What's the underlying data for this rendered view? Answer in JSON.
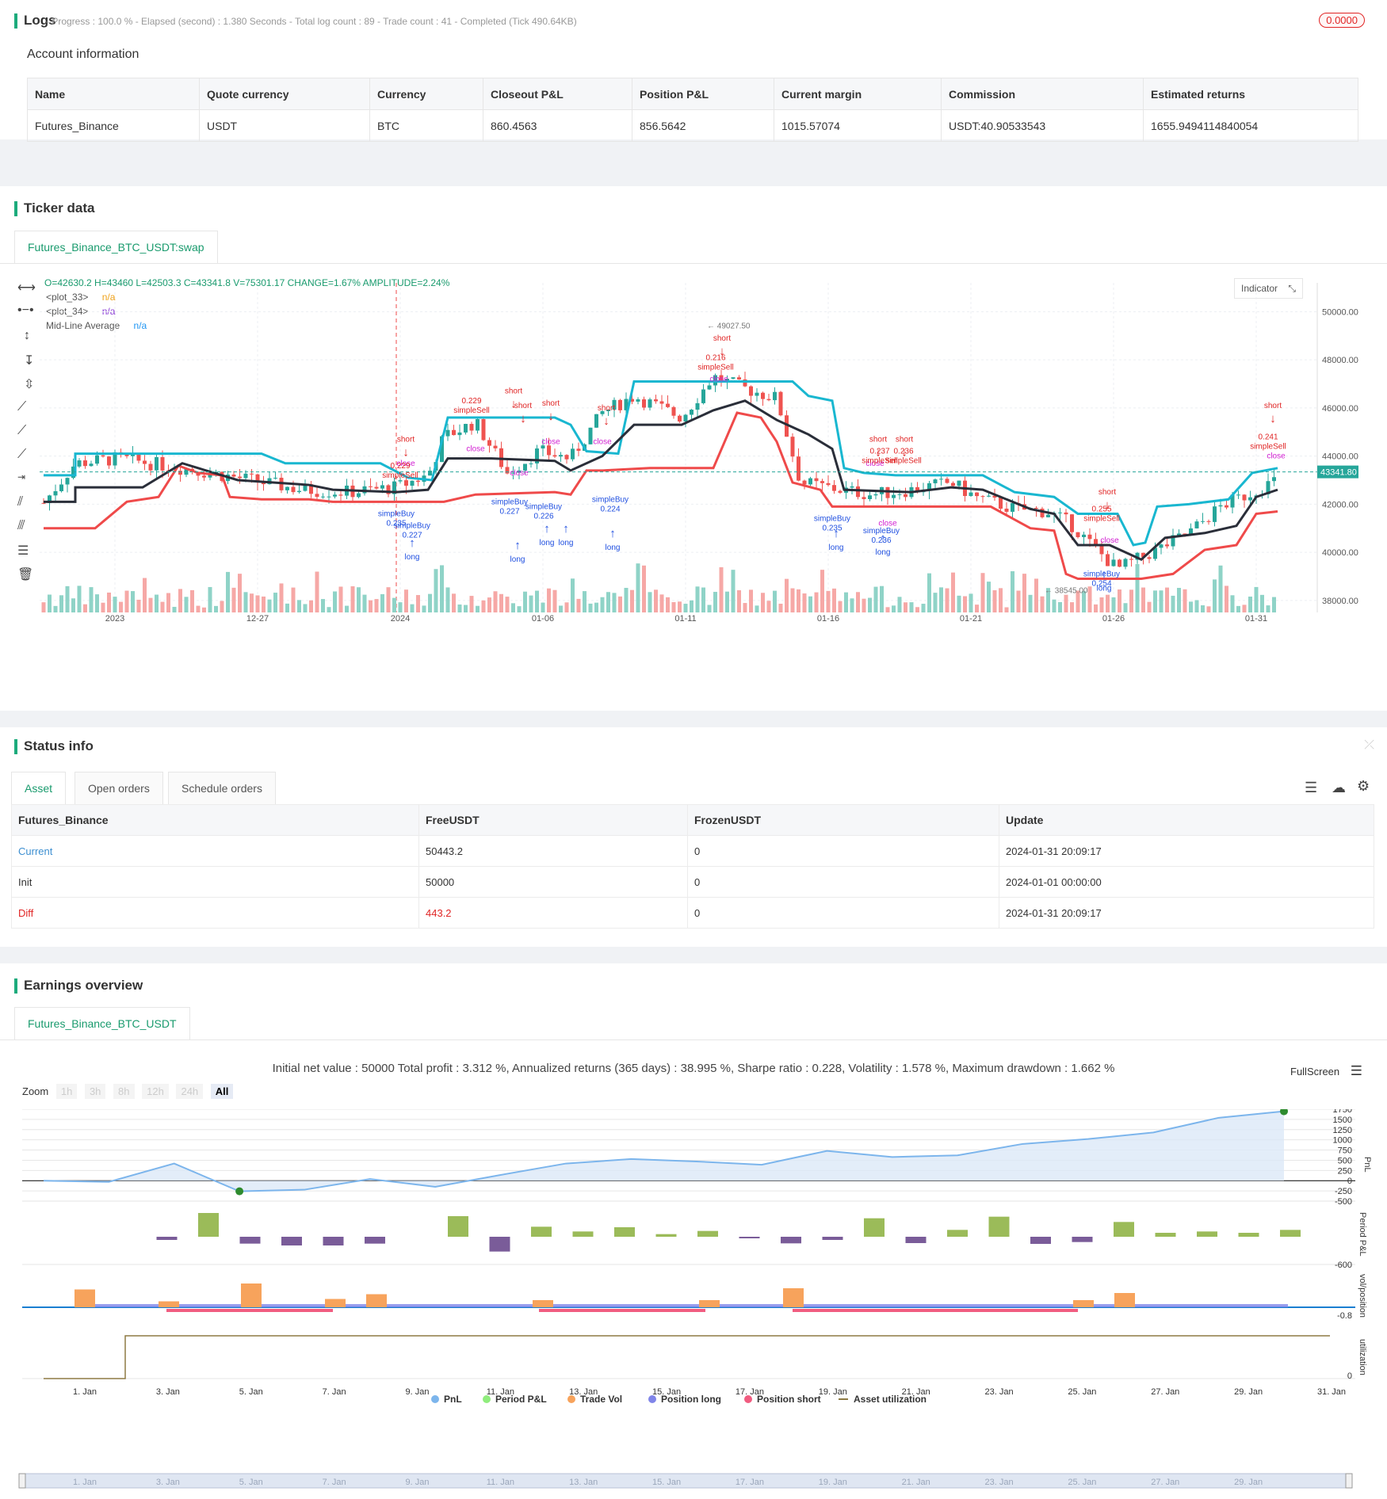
{
  "logs": {
    "title": "Logs",
    "summary": "- Progress : 100.0 % - Elapsed (second) : 1.380 Seconds - Total log count : 89 - Trade count : 41 - Completed (Tick 490.64KB)",
    "badge": "0.0000"
  },
  "account": {
    "heading": "Account information",
    "columns": [
      "Name",
      "Quote currency",
      "Currency",
      "Closeout P&L",
      "Position P&L",
      "Current margin",
      "Commission",
      "Estimated returns"
    ],
    "row": [
      "Futures_Binance",
      "USDT",
      "BTC",
      "860.4563",
      "856.5642",
      "1015.57074",
      "USDT:40.90533543",
      "1655.9494114840054"
    ]
  },
  "ticker": {
    "title": "Ticker data",
    "tab": "Futures_Binance_BTC_USDT:swap",
    "ohlc": "O=42630.2 H=43460 L=42503.3 C=43341.8 V=75301.17 CHANGE=1.67% AMPLITUDE=2.24%",
    "legend": [
      {
        "name": "<plot_33>",
        "value": "n/a",
        "color": "#f0a21a"
      },
      {
        "name": "<plot_34>",
        "value": "n/a",
        "color": "#8c3fd6"
      },
      {
        "name": "Mid-Line Average",
        "value": "n/a",
        "color": "#2196f3"
      }
    ],
    "indicator_btn": "Indicator",
    "last_price": "43341.80",
    "high_label": "49027.50",
    "low_label": "38545.00"
  },
  "chart_data": {
    "type": "candlestick",
    "price_axis": [
      "50000.00",
      "48000.00",
      "46000.00",
      "44000.00",
      "42000.00",
      "40000.00",
      "38000.00"
    ],
    "price_range": [
      37500,
      51200
    ],
    "time_axis": [
      "2023",
      "12-27",
      "2024",
      "01-06",
      "01-11",
      "01-16",
      "01-21",
      "01-26",
      "01-31"
    ],
    "series": [
      {
        "name": "upper",
        "color": "#19b7d0"
      },
      {
        "name": "lower",
        "color": "#ef4a4a"
      },
      {
        "name": "mid",
        "color": "#2a2e39"
      }
    ],
    "current_price": 43341.8,
    "signal_labels": [
      "short",
      "long",
      "close",
      "simpleBuy",
      "simpleSell",
      "0.229",
      "0.235",
      "0.227",
      "0.226",
      "0.224",
      "0.216",
      "0.237",
      "0.236",
      "0.255",
      "0.254",
      "0.241"
    ]
  },
  "status": {
    "title": "Status info",
    "tabs": [
      "Asset",
      "Open orders",
      "Schedule orders"
    ],
    "columns": [
      "Futures_Binance",
      "FreeUSDT",
      "FrozenUSDT",
      "Update"
    ],
    "rows": [
      {
        "label": "Current",
        "free": "50443.2",
        "frozen": "0",
        "update": "2024-01-31 20:09:17",
        "color": "#3d8fd1"
      },
      {
        "label": "Init",
        "free": "50000",
        "frozen": "0",
        "update": "2024-01-01 00:00:00",
        "color": "#333333"
      },
      {
        "label": "Diff",
        "free": "443.2",
        "frozen": "0",
        "update": "2024-01-31 20:09:17",
        "color": "#e02424"
      }
    ]
  },
  "earnings": {
    "title": "Earnings overview",
    "tab": "Futures_Binance_BTC_USDT",
    "summary": "Initial net value : 50000 Total profit : 3.312 %, Annualized returns (365 days) : 38.995 %, Sharpe ratio : 0.228, Volatility : 1.578 %, Maximum drawdown : 1.662 %",
    "fullscreen": "FullScreen",
    "zoom_label": "Zoom",
    "zoom_options": [
      "1h",
      "3h",
      "8h",
      "12h",
      "24h",
      "All"
    ],
    "pnl_axis": [
      "1750",
      "1500",
      "1250",
      "1000",
      "750",
      "500",
      "250",
      "0",
      "-250",
      "-500"
    ],
    "period_axis": [
      "-600"
    ],
    "vol_axis": [
      "-0.8"
    ],
    "util_axis": [
      "0"
    ],
    "axis_titles": [
      "PnL",
      "Period P&L",
      "vol/position",
      "utilization"
    ],
    "x_axis": [
      "1. Jan",
      "3. Jan",
      "5. Jan",
      "7. Jan",
      "9. Jan",
      "11. Jan",
      "13. Jan",
      "15. Jan",
      "17. Jan",
      "19. Jan",
      "21. Jan",
      "23. Jan",
      "25. Jan",
      "27. Jan",
      "29. Jan",
      "31. Jan"
    ],
    "legend": [
      {
        "name": "PnL",
        "color": "#7cb5ec"
      },
      {
        "name": "Period P&L",
        "color": "#90ed7d"
      },
      {
        "name": "Trade Vol",
        "color": "#f7a35c"
      },
      {
        "name": "Position long",
        "color": "#8085e9"
      },
      {
        "name": "Position short",
        "color": "#f15c80"
      },
      {
        "name": "Asset utilization",
        "color": "#8d7a43"
      }
    ],
    "pnl_values": [
      0,
      -30,
      420,
      -260,
      -220,
      40,
      -150,
      140,
      420,
      530,
      470,
      390,
      730,
      580,
      620,
      900,
      1020,
      1180,
      1540,
      1700
    ],
    "period_values": [
      0,
      -120,
      900,
      -260,
      -330,
      -330,
      -260,
      0,
      780,
      -560,
      380,
      200,
      360,
      100,
      220,
      -60,
      -250,
      -120,
      700,
      -240,
      260,
      760,
      -270,
      -200,
      560,
      150,
      200,
      150,
      260
    ],
    "trade_vol": [
      0.75,
      0.25,
      1.0,
      0.35,
      0.55,
      0.3,
      0.3,
      0.8,
      0.3,
      0.6
    ]
  }
}
